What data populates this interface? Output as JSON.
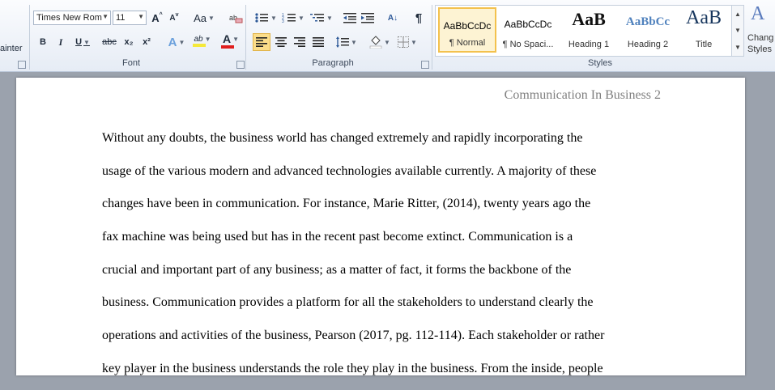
{
  "ribbon": {
    "clipboard": {
      "format_painter_partial": "ainter"
    },
    "font": {
      "group_label": "Font",
      "font_name": "Times New Rom",
      "font_size": "11",
      "grow_font": "A",
      "shrink_font": "A",
      "change_case": "Aa",
      "bold": "B",
      "italic": "I",
      "underline": "U",
      "strikethrough": "abc",
      "subscript": "x₂",
      "superscript": "x²",
      "text_effects": "A",
      "highlight": "ab",
      "font_color": "A",
      "font_color_value": "#e01e1e",
      "highlight_color_value": "#f5e93a"
    },
    "paragraph": {
      "group_label": "Paragraph",
      "sort": "A↓",
      "show_marks": "¶"
    },
    "styles": {
      "group_label": "Styles",
      "tiles": [
        {
          "sample": "AaBbCcDc",
          "name": "¶ Normal",
          "selected": true
        },
        {
          "sample": "AaBbCcDc",
          "name": "¶ No Spaci...",
          "selected": false
        },
        {
          "sample": "AaB",
          "name": "Heading 1",
          "selected": false
        },
        {
          "sample": "AaBbCc",
          "name": "Heading 2",
          "selected": false
        },
        {
          "sample": "AaB",
          "name": "Title",
          "selected": false
        }
      ],
      "change_styles_line1": "Chang",
      "change_styles_line2": "Styles"
    }
  },
  "document": {
    "header": "Communication In Business 2",
    "lines": [
      "Without any doubts, the business world has changed extremely and rapidly incorporating the",
      "usage of the various modern and advanced technologies available currently. A majority of these",
      "changes have been in communication. For instance, Marie Ritter, (2014), twenty years ago the",
      "fax machine was being used but has in the recent past become extinct. Communication is a",
      "crucial and important part of any business; as a matter of fact, it forms the backbone of the",
      "business.  Communication provides a platform for all the stakeholders to understand clearly the",
      "operations and activities of the business, Pearson (2017, pg. 112-114). Each stakeholder or rather",
      "key player in the business understands the role they play in the business.  From the inside, people"
    ]
  }
}
